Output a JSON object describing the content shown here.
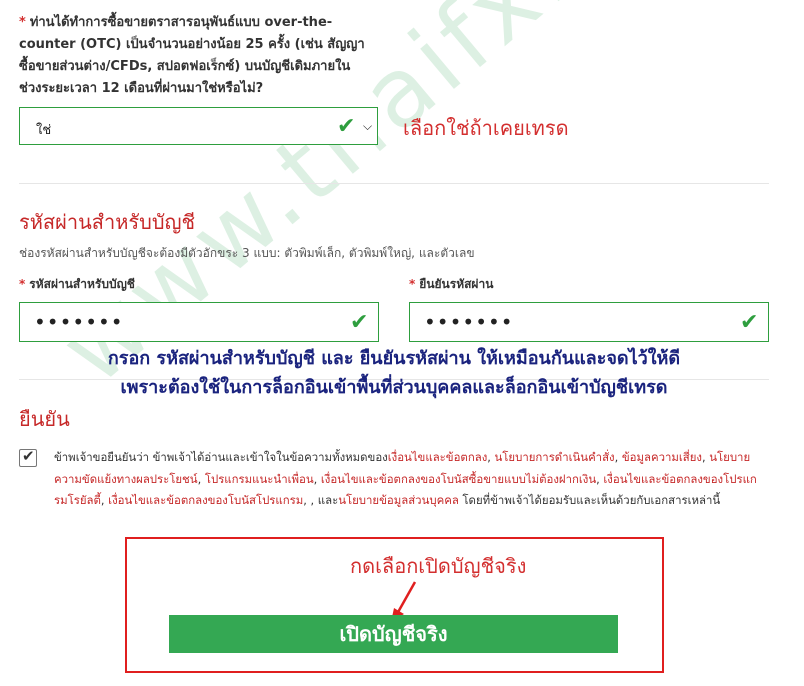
{
  "question": {
    "required_mark": "*",
    "text": "ท่านได้ทำการซื้อขายตราสารอนุพันธ์แบบ over-the-counter (OTC) เป็นจำนวนอย่างน้อย 25 ครั้ง (เช่น สัญญาซื้อขายส่วนต่าง/CFDs, สปอตฟอเร็กซ์) บนบัญชีเดิมภายในช่วงระยะเวลา 12 เดือนที่ผ่านมาใช่หรือไม่?",
    "selected_value": "ใช่",
    "annotation": "เลือกใช่ถ้าเคยเทรด"
  },
  "password_section": {
    "title": "รหัสผ่านสำหรับบัญชี",
    "hint": "ช่องรหัสผ่านสำหรับบัญชีจะต้องมีตัวอักขระ 3 แบบ: ตัวพิมพ์เล็ก, ตัวพิมพ์ใหญ่, และตัวเลข",
    "password_label": "รหัสผ่านสำหรับบัญชี",
    "confirm_label": "ยืนยันรหัสผ่าน",
    "password_value": "•••••••",
    "confirm_value": "•••••••",
    "annotation_line1": "กรอก รหัสผ่านสำหรับบัญชี และ ยืนยันรหัสผ่าน ให้เหมือนกันและจดไว้ให้ดี",
    "annotation_line2": "เพราะต้องใช้ในการล็อกอินเข้าพื้นที่ส่วนบุคคลและล็อกอินเข้าบัญชีเทรด"
  },
  "confirm_section": {
    "title": "ยืนยัน",
    "agree_part1": "ข้าพเจ้าขอยืนยันว่า ข้าพเจ้าได้อ่านและเข้าใจในข้อความทั้งหมดของ",
    "link1": "เงื่อนไขและข้อตกลง",
    "sep1": ", ",
    "link2": "นโยบายการดำเนินคำสั่ง",
    "sep2": ", ",
    "link3": "ข้อมูลความเสี่ยง",
    "sep3": ", ",
    "link4": "นโยบายความขัดแย้งทางผลประโยชน์",
    "sep4": ", ",
    "link5": "โปรแกรมแนะนำเพื่อน",
    "sep5": ", ",
    "link6": "เงื่อนไขและข้อตกลงของโบนัสซื้อขายแบบไม่ต้องฝากเงิน",
    "sep6": ", ",
    "link7": "เงื่อนไขและข้อตกลงของโปรแกรมโรยัลตี้",
    "sep7": ", ",
    "link8": "เงื่อนไขและข้อตกลงของโบนัสโปรแกรม",
    "sep8": ", , และ",
    "link9": "นโยบายข้อมูลส่วนบุคคล",
    "agree_part2": " โดยที่ข้าพเจ้าได้ยอมรับและเห็นด้วยกับเอกสารเหล่านี้",
    "checked_mark": "✔"
  },
  "cta": {
    "annotation": "กดเลือกเปิดบัญชีจริง",
    "button_label": "เปิดบัญชีจริง"
  },
  "watermark": "www.thaifx.com",
  "colors": {
    "green": "#2e9e3e",
    "red": "#d32f2f",
    "navy": "#1a237e",
    "button": "#34a853"
  }
}
